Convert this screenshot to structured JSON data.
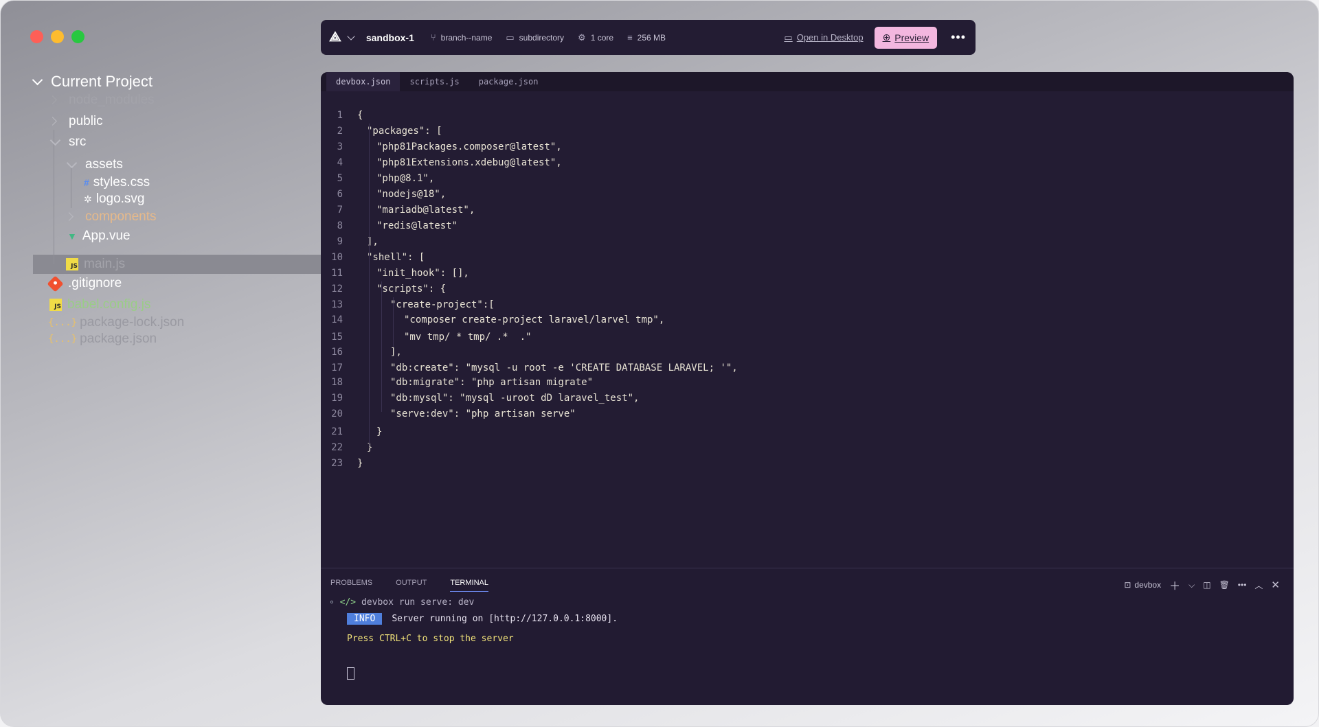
{
  "sidebar": {
    "project_title": "Current Project",
    "items": [
      {
        "label": "node_modules"
      },
      {
        "label": "public"
      },
      {
        "label": "src"
      },
      {
        "label": "assets"
      },
      {
        "label": "styles.css"
      },
      {
        "label": "logo.svg"
      },
      {
        "label": "components"
      },
      {
        "label": "App.vue"
      },
      {
        "label": "main.js"
      },
      {
        "label": ".gitignore"
      },
      {
        "label": "babel.config.js"
      },
      {
        "label": "package-lock.json"
      },
      {
        "label": "package.json"
      }
    ],
    "js_badge": "JS",
    "json_badge": "{...}"
  },
  "toolbar": {
    "sandbox_name": "sandbox-1",
    "branch": "branch--name",
    "directory": "subdirectory",
    "cpu": "1 core",
    "memory": "256 MB",
    "open_desktop": "Open in Desktop",
    "preview": "Preview"
  },
  "editor": {
    "tabs": [
      "devbox.json",
      "scripts.js",
      "package.json"
    ],
    "lines": [
      {
        "n": "1",
        "t": "{"
      },
      {
        "n": "2",
        "t": "\"packages\": ["
      },
      {
        "n": "3",
        "t": "\"php81Packages.composer@latest\","
      },
      {
        "n": "4",
        "t": "\"php81Extensions.xdebug@latest\","
      },
      {
        "n": "5",
        "t": "\"php@8.1\","
      },
      {
        "n": "6",
        "t": "\"nodejs@18\","
      },
      {
        "n": "7",
        "t": "\"mariadb@latest\","
      },
      {
        "n": "8",
        "t": "\"redis@latest\""
      },
      {
        "n": "9",
        "t": "],"
      },
      {
        "n": "10",
        "t": "\"shell\": ["
      },
      {
        "n": "11",
        "t": "\"init_hook\": [],"
      },
      {
        "n": "12",
        "t": "\"scripts\": {"
      },
      {
        "n": "13",
        "t": "\"create-project\":["
      },
      {
        "n": "14",
        "t": "\"composer create-project laravel/larvel tmp\","
      },
      {
        "n": "15",
        "t": "\"mv tmp/ * tmp/ .*  .\""
      },
      {
        "n": "16",
        "t": "],"
      },
      {
        "n": "17",
        "t": "\"db:create\": \"mysql -u root -e 'CREATE DATABASE LARAVEL; '\","
      },
      {
        "n": "18",
        "t": "\"db:migrate\": \"php artisan migrate\""
      },
      {
        "n": "19",
        "t": "\"db:mysql\": \"mysql -uroot dD laravel_test\","
      },
      {
        "n": "20",
        "t": "\"serve:dev\": \"php artisan serve\""
      },
      {
        "n": "21",
        "t": "}"
      },
      {
        "n": "22",
        "t": "}"
      },
      {
        "n": "23",
        "t": "}"
      }
    ]
  },
  "panel": {
    "tabs": [
      "PROBLEMS",
      "OUTPUT",
      "TERMINAL"
    ],
    "terminal_name": "devbox",
    "prompt_symbol": "</>",
    "command": "devbox run serve: dev",
    "info_badge": "INFO",
    "info_message": "Server running on [http://127.0.0.1:8000].",
    "stop_message": "Press CTRL+C to stop the server"
  },
  "colors": {
    "editor_bg": "#231c33",
    "preview_btn": "#f3b7df",
    "info_badge": "#4f7fdc",
    "string": "#e8e3d4",
    "warning_text": "#f2e37a"
  }
}
